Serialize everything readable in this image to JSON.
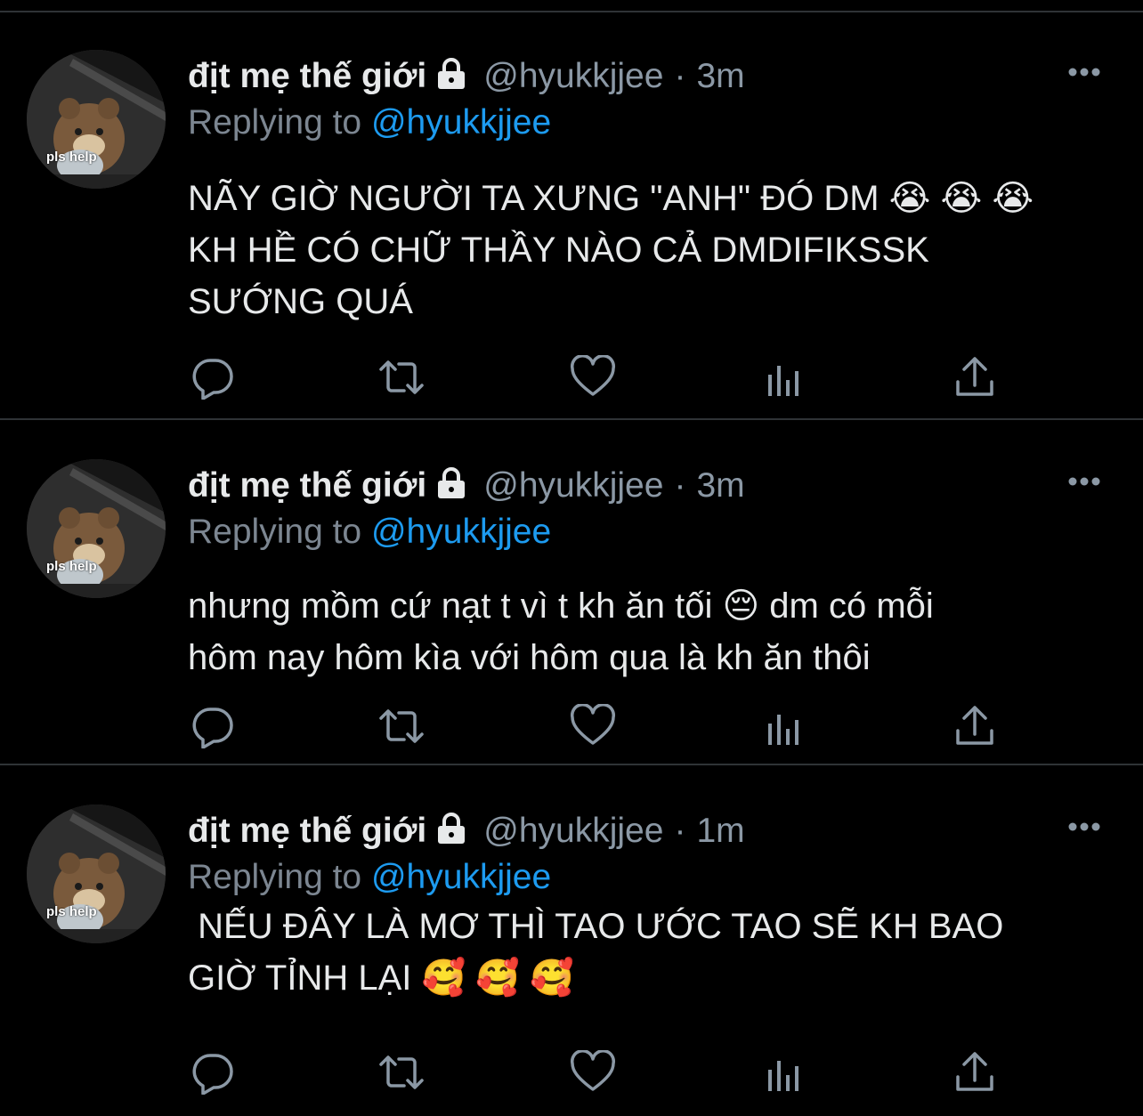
{
  "theme": {
    "background": "#000000",
    "divider": "#2f3336",
    "text": "#e7e9ea",
    "muted": "#8b98a5",
    "accent": "#1d9bf0"
  },
  "tweets": [
    {
      "name": "địt mẹ thế giới",
      "handle": "@hyukkjjee",
      "separator": "·",
      "time": "3m",
      "reply_prefix": "Replying to",
      "reply_to": "@hyukkjjee",
      "avatar_caption": "pls help",
      "text": "NÃY GIỜ NGƯỜI TA XƯNG \"ANH\" ĐÓ DM 😭 😭 😭\nKH HỀ CÓ CHỮ THẦY NÀO CẢ DMDIFIKSSK\nSƯỚNG QUÁ",
      "icons": [
        "lock-icon",
        "more-icon",
        "reply-icon",
        "retweet-icon",
        "like-icon",
        "views-icon",
        "share-icon"
      ]
    },
    {
      "name": "địt mẹ thế giới",
      "handle": "@hyukkjjee",
      "separator": "·",
      "time": "3m",
      "reply_prefix": "Replying to",
      "reply_to": "@hyukkjjee",
      "avatar_caption": "pls help",
      "text": "nhưng mồm cứ nạt t vì t kh ăn tối 😔 dm có mỗi\nhôm nay hôm kìa với hôm qua là kh ăn thôi",
      "icons": [
        "lock-icon",
        "more-icon",
        "reply-icon",
        "retweet-icon",
        "like-icon",
        "views-icon",
        "share-icon"
      ]
    },
    {
      "name": "địt mẹ thế giới",
      "handle": "@hyukkjjee",
      "separator": "·",
      "time": "1m",
      "reply_prefix": "Replying to",
      "reply_to": "@hyukkjjee",
      "avatar_caption": "pls help",
      "text": " NẾU ĐÂY LÀ MƠ THÌ TAO ƯỚC TAO SẼ KH BAO\nGIỜ TỈNH LẠI 🥰 🥰 🥰",
      "icons": [
        "lock-icon",
        "more-icon",
        "reply-icon",
        "retweet-icon",
        "like-icon",
        "views-icon",
        "share-icon"
      ]
    }
  ]
}
